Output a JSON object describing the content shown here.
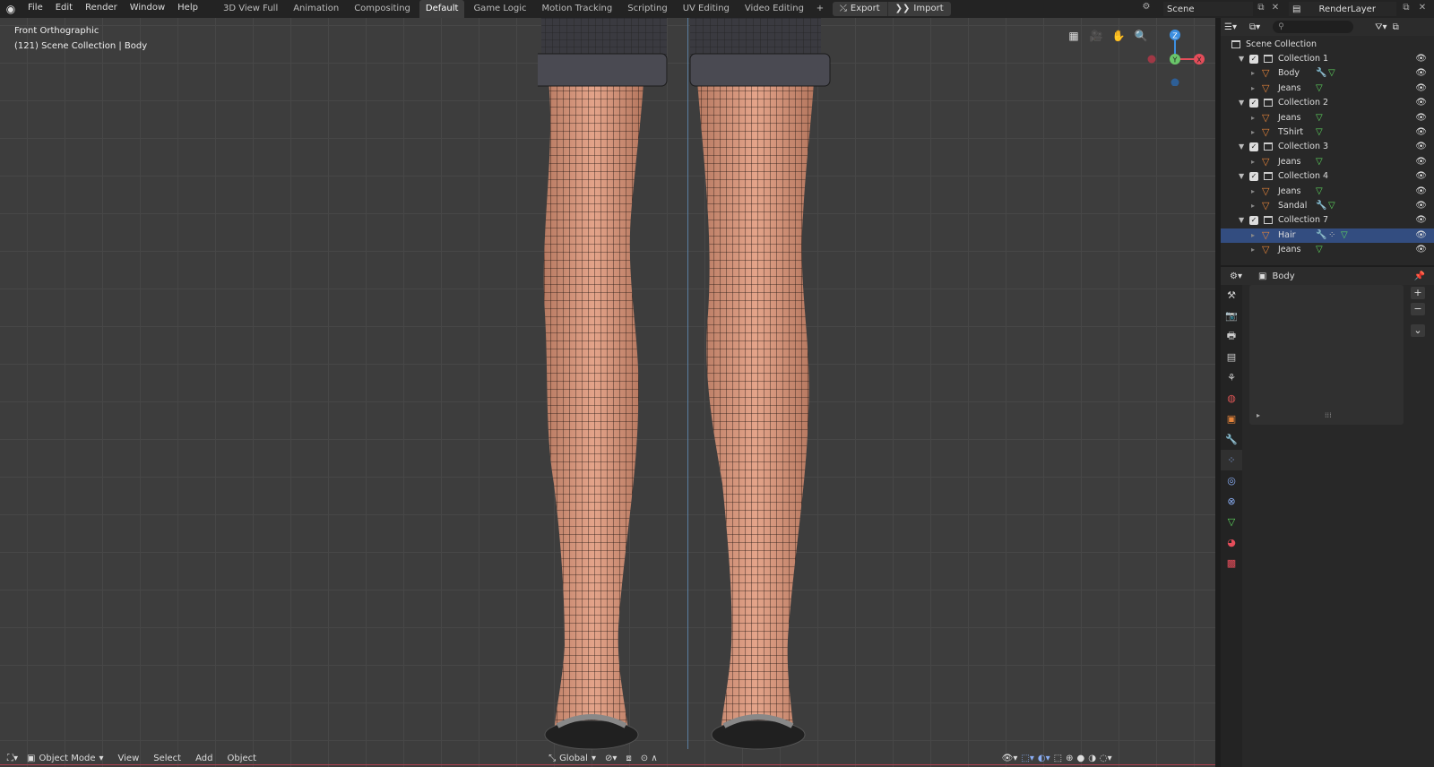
{
  "menu": [
    "File",
    "Edit",
    "Render",
    "Window",
    "Help"
  ],
  "workspaces": [
    {
      "label": "3D View Full"
    },
    {
      "label": "Animation"
    },
    {
      "label": "Compositing"
    },
    {
      "label": "Default",
      "active": true
    },
    {
      "label": "Game Logic"
    },
    {
      "label": "Motion Tracking"
    },
    {
      "label": "Scripting"
    },
    {
      "label": "UV Editing"
    },
    {
      "label": "Video Editing"
    }
  ],
  "io": {
    "export_label": "Export",
    "import_label": "Import"
  },
  "scene": {
    "name": "Scene"
  },
  "view_layer": {
    "name": "RenderLayer"
  },
  "viewport": {
    "view_name": "Front Orthographic",
    "context": "(121) Scene Collection | Body",
    "gizmo": {
      "z": "Z",
      "y": "Y",
      "x": "X"
    }
  },
  "footer": {
    "mode": "Object Mode",
    "menus": [
      "View",
      "Select",
      "Add",
      "Object"
    ],
    "orientation": "Global"
  },
  "outliner": {
    "root": "Scene Collection",
    "search_placeholder": "",
    "rows": [
      {
        "type": "collection",
        "label": "Collection 1"
      },
      {
        "type": "object",
        "label": "Body",
        "modifier": true
      },
      {
        "type": "object",
        "label": "Jeans"
      },
      {
        "type": "collection",
        "label": "Collection 2"
      },
      {
        "type": "object",
        "label": "Jeans"
      },
      {
        "type": "object",
        "label": "TShirt"
      },
      {
        "type": "collection",
        "label": "Collection 3"
      },
      {
        "type": "object",
        "label": "Jeans"
      },
      {
        "type": "collection",
        "label": "Collection 4"
      },
      {
        "type": "object",
        "label": "Jeans"
      },
      {
        "type": "object",
        "label": "Sandal",
        "modifier": true
      },
      {
        "type": "collection",
        "label": "Collection 7"
      },
      {
        "type": "object",
        "label": "Hair",
        "modifier": true,
        "particles": true,
        "selected": true
      },
      {
        "type": "object",
        "label": "Jeans"
      }
    ]
  },
  "properties": {
    "object_name": "Body"
  },
  "colors": {
    "accent_selected": "#334d80",
    "object_icon": "#e3833a",
    "mesh_icon": "#5ed65e",
    "axis_x": "#e44d5a",
    "axis_y": "#6ac66a",
    "axis_z": "#3d8fe0"
  }
}
